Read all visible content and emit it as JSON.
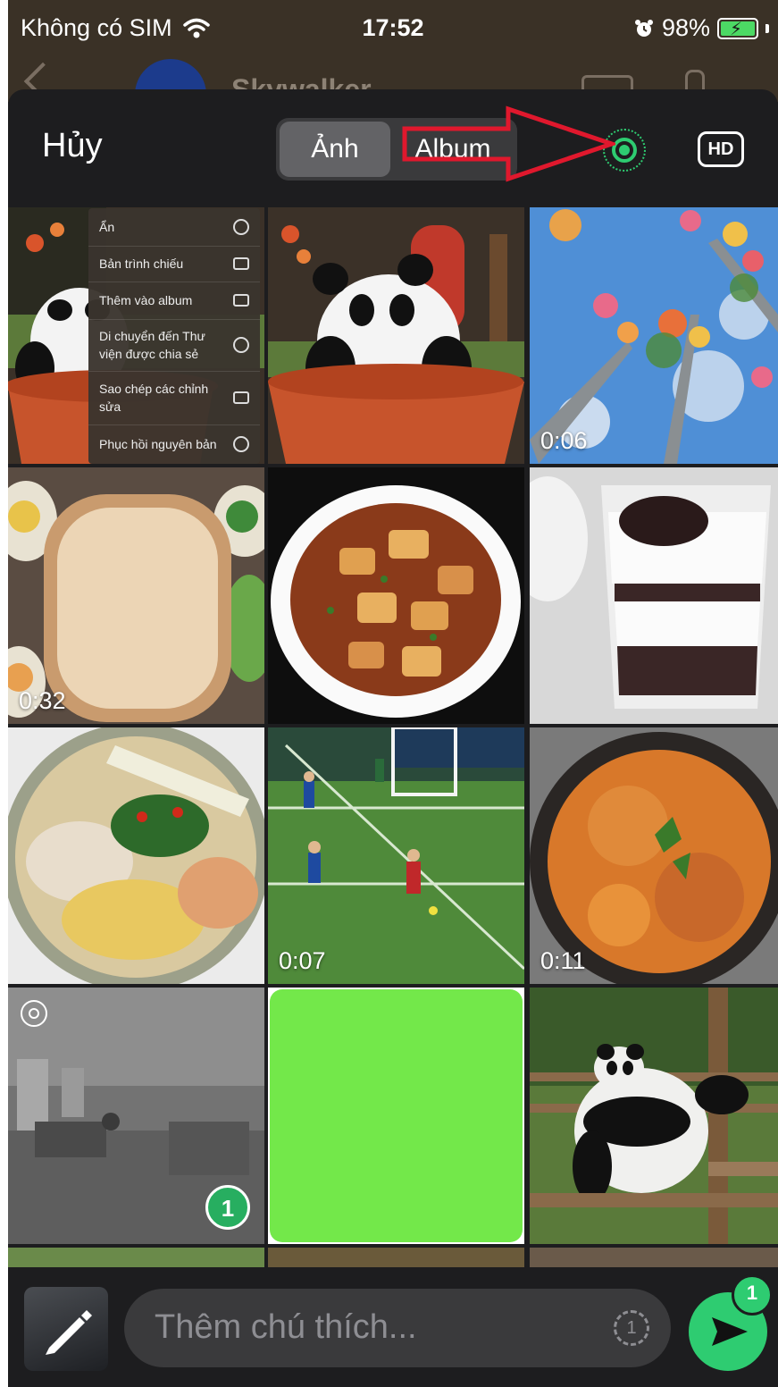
{
  "status_bar": {
    "carrier": "Không có SIM",
    "time": "17:52",
    "battery": "98%"
  },
  "chat_header": {
    "contact_name": "Skywalker"
  },
  "picker": {
    "cancel_label": "Hủy",
    "tabs": [
      {
        "label": "Ảnh",
        "active": true
      },
      {
        "label": "Album",
        "active": false
      }
    ],
    "hd_label": "HD"
  },
  "context_menu": {
    "items": [
      {
        "label": "Ẩn",
        "icon": "eye-icon"
      },
      {
        "label": "Bản trình chiếu",
        "icon": "play-icon"
      },
      {
        "label": "Thêm vào album",
        "icon": "add-album-icon"
      },
      {
        "label": "Di chuyển đến Thư viện được chia sẻ",
        "icon": "people-icon"
      },
      {
        "label": "Sao chép các chỉnh sửa",
        "icon": "copy-icon"
      },
      {
        "label": "Phục hồi nguyên bản",
        "icon": "revert-icon"
      }
    ]
  },
  "photos": [
    {
      "kind": "panda-pot",
      "duration": ""
    },
    {
      "kind": "panda-pot",
      "duration": ""
    },
    {
      "kind": "flower-sky",
      "duration": "0:06"
    },
    {
      "kind": "bento-box",
      "duration": "0:32"
    },
    {
      "kind": "mapo-tofu",
      "duration": ""
    },
    {
      "kind": "dessert",
      "duration": ""
    },
    {
      "kind": "noodle-salad",
      "duration": ""
    },
    {
      "kind": "football",
      "duration": "0:07"
    },
    {
      "kind": "fried-noodles",
      "duration": "0:11"
    },
    {
      "kind": "office-live",
      "duration": "",
      "selected_number": "1"
    },
    {
      "kind": "green-screen",
      "duration": ""
    },
    {
      "kind": "panda-outdoor",
      "duration": ""
    }
  ],
  "caption": {
    "placeholder": "Thêm chú thích...",
    "timer_label": "1"
  },
  "send": {
    "count": "1"
  },
  "colors": {
    "accent_green": "#2ecc71",
    "annotation_red": "#e0182d"
  }
}
